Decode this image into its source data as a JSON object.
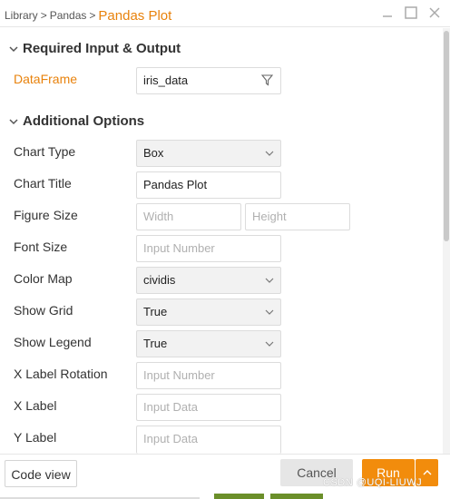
{
  "breadcrumb": {
    "library": "Library",
    "sep1": ">",
    "pandas": "Pandas",
    "sep2": ">",
    "current": "Pandas Plot"
  },
  "sections": {
    "required": "Required Input & Output",
    "additional": "Additional Options"
  },
  "required": {
    "dataframe_label": "DataFrame",
    "dataframe_value": "iris_data"
  },
  "options": {
    "chart_type_label": "Chart Type",
    "chart_type_value": "Box",
    "chart_title_label": "Chart Title",
    "chart_title_value": "Pandas Plot",
    "figure_size_label": "Figure Size",
    "width_placeholder": "Width",
    "height_placeholder": "Height",
    "font_size_label": "Font Size",
    "font_size_placeholder": "Input Number",
    "color_map_label": "Color Map",
    "color_map_value": "cividis",
    "show_grid_label": "Show Grid",
    "show_grid_value": "True",
    "show_legend_label": "Show Legend",
    "show_legend_value": "True",
    "x_rotation_label": "X Label Rotation",
    "x_rotation_placeholder": "Input Number",
    "x_label_label": "X Label",
    "x_label_placeholder": "Input Data",
    "y_label_label": "Y Label",
    "y_label_placeholder": "Input Data"
  },
  "footer": {
    "code_view": "Code view",
    "cancel": "Cancel",
    "run": "Run",
    "watermark": "CSDN @UQI-LIUWJ"
  },
  "colors": {
    "accent": "#e8820c",
    "run": "#f28c0c"
  }
}
